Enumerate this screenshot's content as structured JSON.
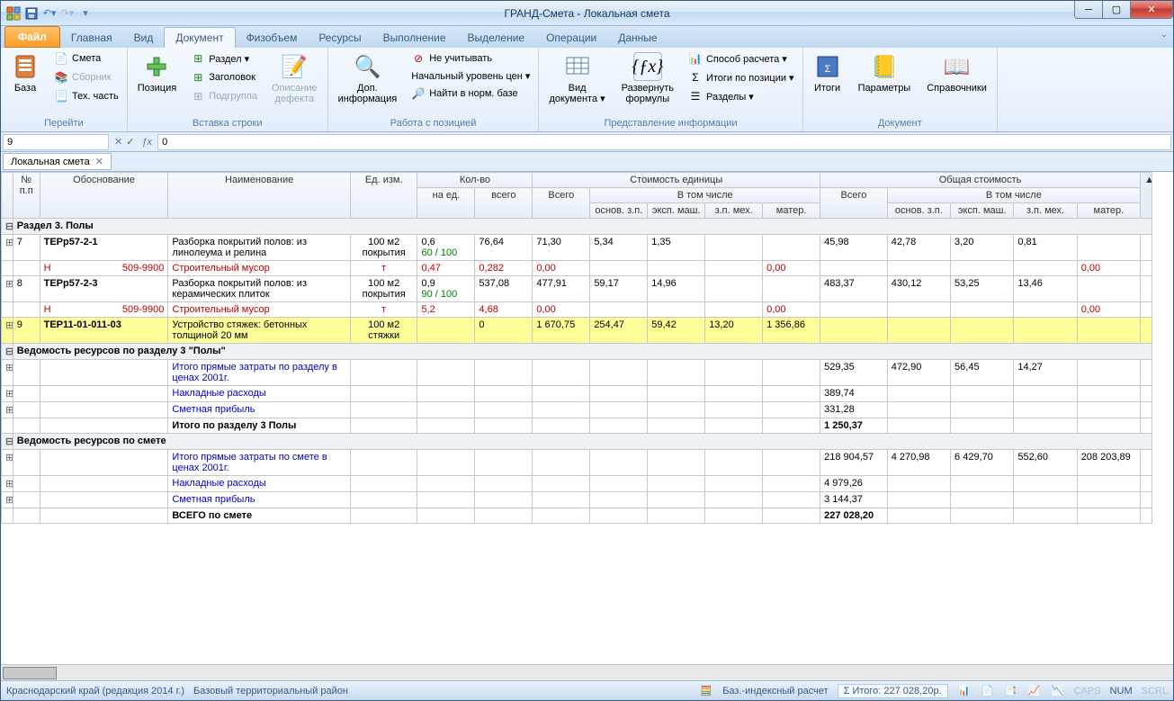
{
  "window_title": "ГРАНД-Смета - Локальная смета",
  "file_tab": "Файл",
  "tabs": [
    "Главная",
    "Вид",
    "Документ",
    "Физобъем",
    "Ресурсы",
    "Выполнение",
    "Выделение",
    "Операции",
    "Данные"
  ],
  "active_tab": "Документ",
  "ribbon": {
    "group_perejti": "Перейти",
    "baza": "База",
    "smeta": "Смета",
    "sbornik": "Сборник",
    "techchast": "Тех. часть",
    "group_vstavka": "Вставка строки",
    "pozitsiya": "Позиция",
    "razdel": "Раздел ▾",
    "zagolovok": "Заголовок",
    "podgruppa": "Подгруппа",
    "opisanie": "Описание\nдефекта",
    "group_rabota": "Работа с позицией",
    "dopinfo": "Доп.\nинформация",
    "neuchit": "Не учитывать",
    "nachuroven": "Начальный уровень цен ▾",
    "najti": "Найти в норм. базе",
    "group_predstav": "Представление информации",
    "viddok": "Вид\nдокумента ▾",
    "razvernut": "Развернуть\nформулы",
    "sposob": "Способ расчета ▾",
    "itogipoz": "Итоги по позиции ▾",
    "razdely": "Разделы ▾",
    "group_dokument": "Документ",
    "itogi": "Итоги",
    "parametry": "Параметры",
    "spravochniki": "Справочники"
  },
  "formula": {
    "cell": "9",
    "value": "0"
  },
  "doctab": "Локальная смета",
  "headers": {
    "npp": "№\nп.п",
    "obosn": "Обоснование",
    "naim": "Наименование",
    "edizm": "Ед. изм.",
    "kolvo": "Кол-во",
    "naed": "на ед.",
    "vsego": "всего",
    "stoim_ed": "Стоимость единицы",
    "obsh_stoim": "Общая стоимость",
    "vsego2": "Всего",
    "vtom": "В том числе",
    "osnov": "основ. з.п.",
    "eksp": "эксп. маш.",
    "zpmex": "з.п. мех.",
    "mater": "матер."
  },
  "rows": [
    {
      "type": "section",
      "exp": "⊟",
      "text": "Раздел 3. Полы"
    },
    {
      "type": "item",
      "n": "7",
      "obosn": "ТЕРр57-2-1",
      "naim": "Разборка покрытий полов: из линолеума и релина",
      "ed": "100 м2 покрытия",
      "naed": "0,6",
      "naed2": "60 / 100",
      "vsego": "76,64",
      "c1": "71,30",
      "c2": "5,34",
      "c3": "1,35",
      "c4": "",
      "t1": "45,98",
      "t2": "42,78",
      "t3": "3,20",
      "t4": "0,81",
      "t5": ""
    },
    {
      "type": "sub",
      "obosn": "Н",
      "code": "509-9900",
      "naim": "Строительный мусор",
      "ed": "т",
      "naed": "0,47",
      "vsego": "0,282",
      "c1": "0,00",
      "t1": "0,00",
      "t5": "0,00"
    },
    {
      "type": "item",
      "n": "8",
      "obosn": "ТЕРр57-2-3",
      "naim": "Разборка покрытий полов: из керамических плиток",
      "ed": "100 м2 покрытия",
      "naed": "0,9",
      "naed2": "90 / 100",
      "vsego": "537,08",
      "c1": "477,91",
      "c2": "59,17",
      "c3": "14,96",
      "c4": "",
      "t1": "483,37",
      "t2": "430,12",
      "t3": "53,25",
      "t4": "13,46",
      "t5": ""
    },
    {
      "type": "sub",
      "obosn": "Н",
      "code": "509-9900",
      "naim": "Строительный мусор",
      "ed": "т",
      "naed": "5,2",
      "vsego": "4,68",
      "c1": "0,00",
      "t1": "0,00",
      "t5": "0,00"
    },
    {
      "type": "hl",
      "n": "9",
      "obosn": "ТЕР11-01-011-03",
      "naim": "Устройство стяжек: бетонных толщиной 20 мм",
      "ed": "100 м2 стяжки",
      "naed": "",
      "vsego": "0",
      "c_all": "1 670,75",
      "c1": "254,47",
      "c2": "59,42",
      "c3": "13,20",
      "c4": "1 356,86",
      "t1": "",
      "t2": "",
      "t3": "",
      "t4": "",
      "t5": ""
    },
    {
      "type": "section",
      "exp": "⊟",
      "text": "Ведомость ресурсов по разделу 3 \"Полы\""
    },
    {
      "type": "summary",
      "naim": "Итого прямые затраты по разделу в ценах 2001г.",
      "t1": "529,35",
      "t2": "472,90",
      "t3": "56,45",
      "t4": "14,27",
      "t5": ""
    },
    {
      "type": "summary",
      "naim": "Накладные расходы",
      "t1": "389,74"
    },
    {
      "type": "summary",
      "naim": "Сметная прибыль",
      "t1": "331,28"
    },
    {
      "type": "total",
      "naim": "Итого по разделу 3 Полы",
      "t1": "1 250,37"
    },
    {
      "type": "section",
      "exp": "⊟",
      "text": "Ведомость ресурсов по смете"
    },
    {
      "type": "summary",
      "naim": "Итого прямые затраты по смете в ценах 2001г.",
      "t1": "218 904,57",
      "t2": "4 270,98",
      "t3": "6 429,70",
      "t4": "552,60",
      "t5": "208 203,89"
    },
    {
      "type": "summary",
      "naim": "Накладные расходы",
      "t1": "4 979,26"
    },
    {
      "type": "summary",
      "naim": "Сметная прибыль",
      "t1": "3 144,37"
    },
    {
      "type": "total",
      "naim": "ВСЕГО по смете",
      "t1": "227 028,20"
    }
  ],
  "status": {
    "region": "Краснодарский край (редакция 2014 г.)",
    "area": "Базовый территориальный район",
    "calc": "Баз.-индексный расчет",
    "itogo": "Σ Итого: 227 028,20р.",
    "caps": "CAPS",
    "num": "NUM",
    "scrl": "SCRL"
  }
}
